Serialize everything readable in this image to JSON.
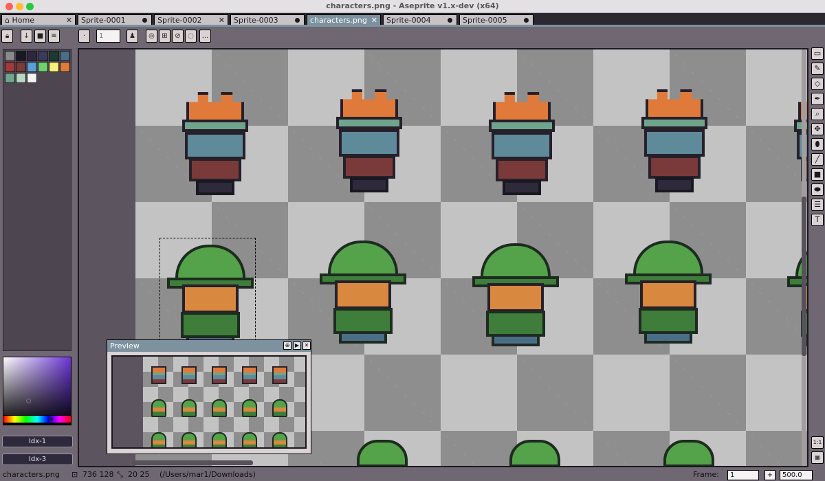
{
  "window": {
    "title": "characters.png - Aseprite v1.x-dev (x64)"
  },
  "traffic_lights": [
    "#ff5f57",
    "#febc2e",
    "#28c840"
  ],
  "tabs": [
    {
      "label": "Home",
      "icon": "home-icon",
      "closable": "x"
    },
    {
      "label": "Sprite-0001",
      "icon": "",
      "closable": "dot"
    },
    {
      "label": "Sprite-0002",
      "icon": "",
      "closable": "x"
    },
    {
      "label": "Sprite-0003",
      "icon": "",
      "closable": "dot"
    },
    {
      "label": "characters.png",
      "icon": "",
      "closable": "x",
      "active": true
    },
    {
      "label": "Sprite-0004",
      "icon": "",
      "closable": "dot"
    },
    {
      "label": "Sprite-0005",
      "icon": "",
      "closable": "dot"
    }
  ],
  "toolbar": {
    "brush_size_placeholder": "1",
    "buttons": [
      "lock-icon",
      "download-icon",
      "square-icon",
      "menu-icon",
      "brush-shape-icon",
      "pressure-icon",
      "symmetry-icon",
      "pattern-icon",
      "ink-icon",
      "more-icon"
    ],
    "more_label": "..."
  },
  "palette": {
    "colors": [
      "#8a8a8a",
      "#1a1820",
      "#2b2840",
      "#3a3a5a",
      "#1d3a2e",
      "#4a6e88",
      "#a33a3a",
      "#7a3a3a",
      "#5aa0d8",
      "#6fd070",
      "#f5f07a",
      "#e07a3a",
      "#6fa58c",
      "#b7d7c3",
      "#f2f2f2"
    ]
  },
  "color_buttons": {
    "fg": "Idx-1",
    "bg": "Idx-3"
  },
  "preview": {
    "title": "Preview",
    "buttons": [
      "⊕",
      "▶",
      "✕"
    ]
  },
  "right_tools": [
    "▭",
    "✎",
    "◇",
    "✒",
    "⌕",
    "✥",
    "⬮",
    "╱",
    "■",
    "⬬",
    "☰",
    "T"
  ],
  "right_tools_bottom": [
    "1:1",
    "▦"
  ],
  "status": {
    "filename": "characters.png",
    "position": "736 128",
    "size": "20 25",
    "path": "(/Users/mar1/Downloads)",
    "frame_label": "Frame:",
    "frame_value": "1",
    "zoom_value": "500.0"
  }
}
